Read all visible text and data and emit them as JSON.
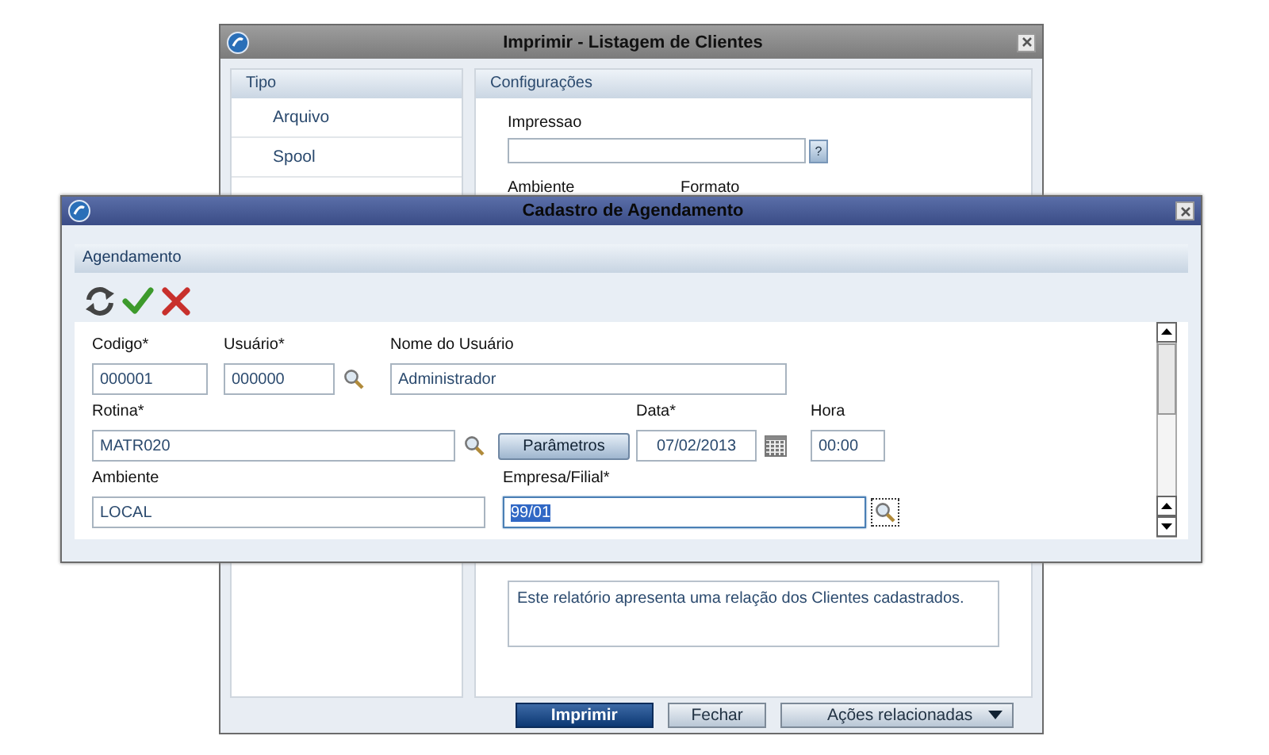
{
  "back_window": {
    "title": "Imprimir - Listagem de Clientes",
    "tipo": {
      "header": "Tipo",
      "items": [
        {
          "label": "Arquivo",
          "selected": false
        },
        {
          "label": "Spool",
          "selected": false
        }
      ]
    },
    "configuracoes": {
      "header": "Configurações",
      "impressao_label": "Impressao",
      "help_button": "?",
      "ambiente_label": "Ambiente",
      "formato_label": "Formato",
      "description": "Este relatório apresenta uma relação dos Clientes cadastrados."
    },
    "buttons": [
      {
        "label": "Imprimir",
        "kind": "primary"
      },
      {
        "label": "Fechar",
        "kind": "normal"
      },
      {
        "label": "Ações relacionadas",
        "kind": "dropdown"
      }
    ]
  },
  "front_window": {
    "title": "Cadastro de Agendamento",
    "section": "Agendamento",
    "toolbar": [
      {
        "kind": "refresh"
      },
      {
        "kind": "confirm"
      },
      {
        "kind": "cancel"
      }
    ],
    "rows": [
      [
        {
          "kind": "field",
          "label": "Codigo*",
          "value": "000001",
          "focused": false
        },
        {
          "kind": "lookup",
          "label": "Usuário*",
          "value": "000000",
          "focused": false
        },
        {
          "kind": "field",
          "label": "Nome do Usuário",
          "value": "Administrador",
          "focused": false
        }
      ],
      [
        {
          "kind": "lookup",
          "label": "Rotina*",
          "value": "MATR020",
          "focused": false
        },
        {
          "kind": "button",
          "label": "Parâmetros"
        },
        {
          "kind": "date",
          "label": "Data*",
          "value": "07/02/2013",
          "focused": false
        },
        {
          "kind": "field",
          "label": "Hora",
          "value": "00:00",
          "focused": false
        }
      ],
      [
        {
          "kind": "field",
          "label": "Ambiente",
          "value": "LOCAL",
          "focused": false
        },
        {
          "kind": "lookup",
          "label": "Empresa/Filial*",
          "value": "99/01",
          "focused": true
        }
      ]
    ]
  }
}
